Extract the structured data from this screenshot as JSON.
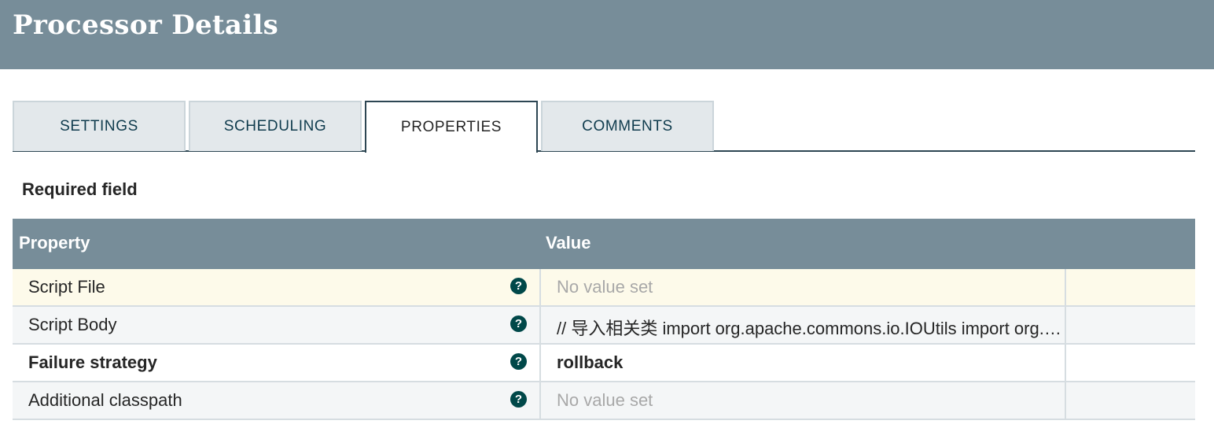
{
  "header": {
    "title": "Processor Details"
  },
  "tabs": [
    {
      "label": "SETTINGS"
    },
    {
      "label": "SCHEDULING"
    },
    {
      "label": "PROPERTIES"
    },
    {
      "label": "COMMENTS"
    }
  ],
  "active_tab": "PROPERTIES",
  "required_label": "Required field",
  "grid": {
    "columns": {
      "property": "Property",
      "value": "Value"
    },
    "rows": [
      {
        "property": "Script File",
        "value": "No value set",
        "required": false,
        "value_set": false,
        "highlighted": true
      },
      {
        "property": "Script Body",
        "value": "// 导入相关类 import org.apache.commons.io.IOUtils import org.apache.nifi.processor.io.StreamCallback",
        "required": false,
        "value_set": true,
        "highlighted": false
      },
      {
        "property": "Failure strategy",
        "value": "rollback",
        "required": true,
        "value_set": true,
        "highlighted": false
      },
      {
        "property": "Additional classpath",
        "value": "No value set",
        "required": false,
        "value_set": false,
        "highlighted": false
      }
    ]
  },
  "icons": {
    "help": "question-circle-icon"
  },
  "colors": {
    "header_bg": "#778d99",
    "help_icon": "#004849",
    "row_highlight": "#fdfaea",
    "tab_border_active": "#2d4653"
  }
}
